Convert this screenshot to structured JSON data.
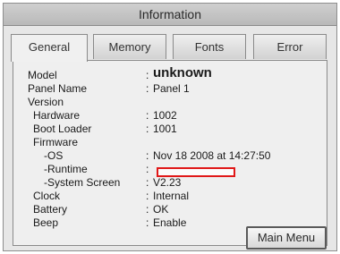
{
  "window": {
    "title": "Information"
  },
  "tabs": [
    {
      "label": "General"
    },
    {
      "label": "Memory"
    },
    {
      "label": "Fonts"
    },
    {
      "label": "Error"
    }
  ],
  "info": {
    "model_label": "Model",
    "model_value": "unknown",
    "panel_name_label": "Panel Name",
    "panel_name_value": "Panel 1",
    "version_label": "Version",
    "hardware_label": "Hardware",
    "hardware_value": "1002",
    "boot_loader_label": "Boot Loader",
    "boot_loader_value": "1001",
    "firmware_label": "Firmware",
    "os_label": "-OS",
    "os_value": "Nov 18 2008 at 14:27:50",
    "runtime_label": "-Runtime",
    "runtime_value": "",
    "system_screen_label": "-System Screen",
    "system_screen_value": "V2.23",
    "clock_label": "Clock",
    "clock_value": "Internal",
    "battery_label": "Battery",
    "battery_value": "OK",
    "beep_label": "Beep",
    "beep_value": "Enable",
    "colon": ":"
  },
  "buttons": {
    "main_menu": "Main Menu"
  },
  "colors": {
    "highlight_box": "#e01818"
  }
}
